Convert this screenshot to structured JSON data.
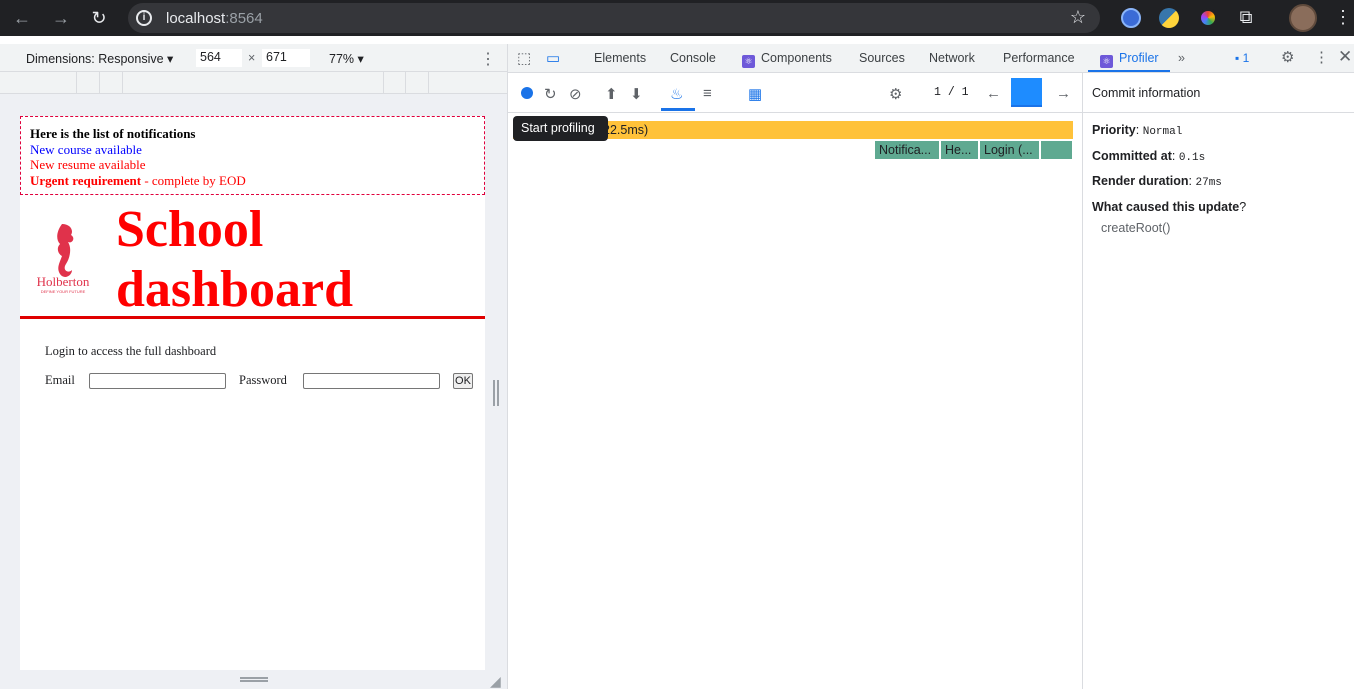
{
  "browser": {
    "url_host": "localhost",
    "url_port": ":8564"
  },
  "device_toolbar": {
    "dimensions_label": "Dimensions: Responsive",
    "width": "564",
    "height": "671",
    "x_sep": "×",
    "zoom": "77%"
  },
  "page": {
    "notifications": {
      "title": "Here is the list of notifications",
      "items": [
        "New course available",
        "New resume available"
      ],
      "urgent_bold": "Urgent requirement",
      "urgent_rest": " - complete by EOD"
    },
    "logo_text": "Holberton",
    "logo_tagline": "DEFINE YOUR FUTURE",
    "header_line1": "School",
    "header_line2": "dashboard",
    "login_text": "Login to access the full dashboard",
    "email_label": "Email",
    "password_label": "Password",
    "ok_label": "OK"
  },
  "devtools": {
    "tabs": [
      "Elements",
      "Console",
      "Components",
      "Sources",
      "Network",
      "Performance",
      "Profiler"
    ],
    "issues_count": "1",
    "commit_index": "1",
    "commit_sep": "/",
    "commit_total": "1",
    "tooltip": "Start profiling",
    "flame_root_label": "22.5ms)",
    "flame_children": [
      "Notifica...",
      "He...",
      "Login (..."
    ],
    "side": {
      "header": "Commit information",
      "priority_label": "Priority",
      "priority_value": "Normal",
      "committed_label": "Committed at",
      "committed_value": "0.1s",
      "render_label": "Render duration",
      "render_value": "27ms",
      "cause_label": "What caused this update",
      "cause_q": "?",
      "cause_value": "createRoot()"
    }
  },
  "colors": {
    "accent": "#1a73e8",
    "flame_root": "#ffc23a",
    "flame_child": "#5fa991",
    "header_red": "#ff0000"
  }
}
